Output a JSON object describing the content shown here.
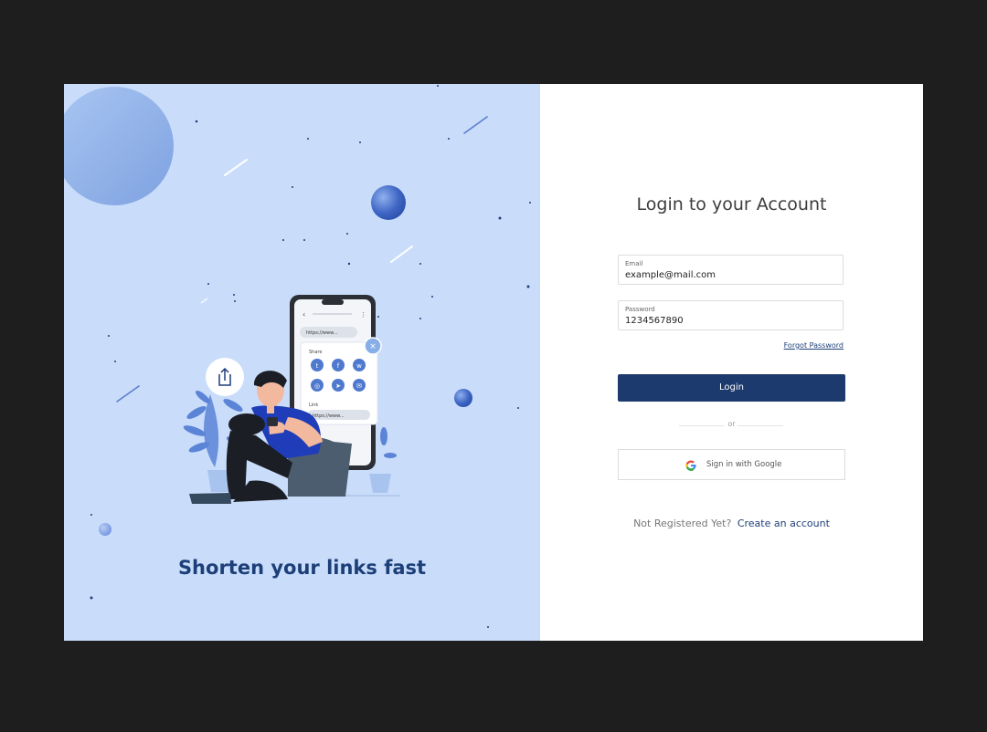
{
  "hero": {
    "tagline": "Shorten your links fast",
    "phone": {
      "url_bar": "https://www...",
      "share_title": "Share",
      "link_title": "Link",
      "link_value": "https://www..."
    }
  },
  "login": {
    "heading": "Login to your Account",
    "email": {
      "label": "Email",
      "value": "example@mail.com"
    },
    "password": {
      "label": "Password",
      "value": "1234567890"
    },
    "forgot_label": "Forgot Password",
    "login_label": "Login",
    "or_label": "or",
    "google_label": "Sign in with Google",
    "register_question": "Not Registered Yet?",
    "register_link": "Create an account"
  },
  "colors": {
    "panel_bg": "#c9ddfb",
    "brand_dark": "#1c3a6e",
    "accent_blue": "#2f5bd6"
  }
}
